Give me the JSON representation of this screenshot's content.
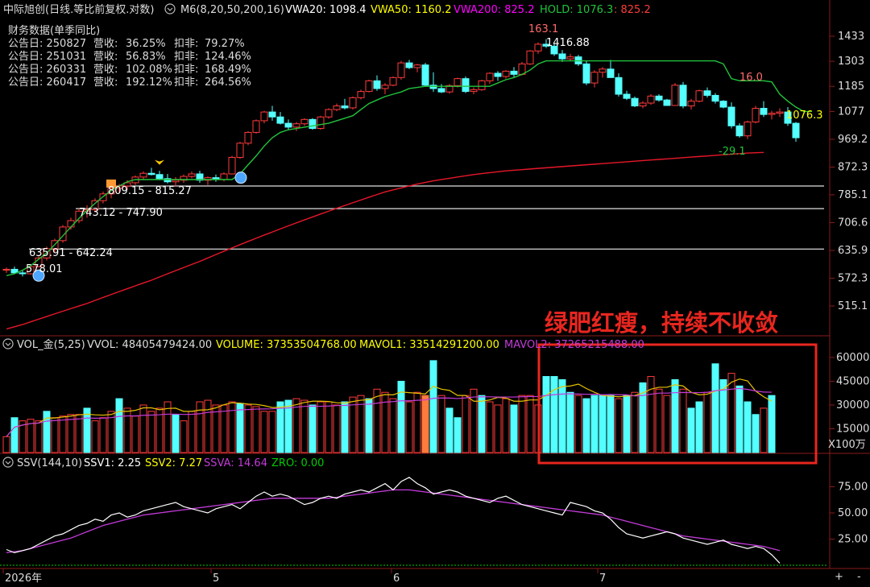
{
  "header": {
    "symbol": "中际旭创(日线.等比前复权.对数)",
    "indicator": "M6(8,20,50,200,16)",
    "vwa20": "VWA20: 1098.4",
    "vwa50": "VWA50: 1160.2",
    "vwa200": "VWA200: 825.2",
    "hold": "HOLD: 1076.3",
    "hold_extra": ": 825.2"
  },
  "finance": {
    "title": "财务数据(单季同比)",
    "rows": [
      {
        "date": "公告日: 250827",
        "rev_label": "营收:",
        "rev": "36.25%",
        "np_label": "扣非:",
        "np": "79.27%"
      },
      {
        "date": "公告日: 251031",
        "rev_label": "营收:",
        "rev": "56.83%",
        "np_label": "扣非:",
        "np": "124.46%"
      },
      {
        "date": "公告日: 260331",
        "rev_label": "营收:",
        "rev": "102.08%",
        "np_label": "扣非:",
        "np": "168.49%"
      },
      {
        "date": "公告日: 260417",
        "rev_label": "营收:",
        "rev": "192.12%",
        "np_label": "扣非:",
        "np": "264.56%"
      }
    ]
  },
  "annotations": {
    "high_pct": "163.1",
    "high_price": "1416.88",
    "low_price": "578.01",
    "range1": "635.91 - 642.24",
    "range2": "743.12 - 747.90",
    "range3": "809.15 - 815.27",
    "pct_16": "16.0",
    "pct_m29": "-29.1",
    "hold_label": "1076.3",
    "callout": "绿肥红瘦，持续不收敛"
  },
  "volume_header": {
    "name": "VOL_金(5,25)",
    "vvol": "VVOL: 48405479424.00",
    "volume": "VOLUME: 37353504768.00",
    "mavol1": "MAVOL1: 33514291200.00",
    "mavol2": "MAVOL2: 37265215488.00"
  },
  "ssv_header": {
    "name": "SSV(144,10)",
    "ssv1": "SSV1: 2.25",
    "ssv2": "SSV2: 7.27",
    "ssva": "SSVA: 14.64",
    "zro": "ZRO: 0.00"
  },
  "axes": {
    "price_ticks": [
      "1433",
      "1303",
      "1185",
      "1077",
      "969.2",
      "872.3",
      "785.1",
      "706.6",
      "635.9",
      "572.3",
      "515.1"
    ],
    "vol_ticks": [
      "60000",
      "45000",
      "30000",
      "15000"
    ],
    "vol_unit": "X100万",
    "ssv_ticks": [
      "75.00",
      "50.00",
      "25.00"
    ],
    "x_labels": [
      "2026年",
      "5",
      "6",
      "7"
    ],
    "zoom_plus": "+",
    "zoom_minus": "-"
  },
  "colors": {
    "up": "#ff3b3b",
    "down": "#54ffff",
    "vwa20": "#ffff00",
    "vwa50": "#ff00ff",
    "vwa200": "#e8172a",
    "hold": "#22c33c",
    "ssv1": "#ffffff",
    "ssva": "#c33bd9",
    "zro": "#00cc00",
    "callout": "#e8261f"
  },
  "chart_data": {
    "type": "candlestick",
    "title": "中际旭创(日线.等比前复权.对数)",
    "y_scale": "log",
    "ylim": [
      470,
      1500
    ],
    "candles": [
      [
        590,
        596,
        584,
        592
      ],
      [
        592,
        598,
        586,
        584
      ],
      [
        584,
        590,
        576,
        582
      ],
      [
        582,
        600,
        580,
        598
      ],
      [
        598,
        622,
        596,
        618
      ],
      [
        618,
        645,
        612,
        640
      ],
      [
        640,
        665,
        632,
        660
      ],
      [
        660,
        700,
        655,
        695
      ],
      [
        695,
        720,
        688,
        712
      ],
      [
        712,
        745,
        705,
        738
      ],
      [
        738,
        755,
        720,
        742
      ],
      [
        742,
        775,
        735,
        768
      ],
      [
        768,
        795,
        760,
        788
      ],
      [
        788,
        812,
        775,
        805
      ],
      [
        805,
        818,
        790,
        812
      ],
      [
        812,
        830,
        800,
        822
      ],
      [
        822,
        845,
        815,
        840
      ],
      [
        840,
        858,
        832,
        852
      ],
      [
        852,
        870,
        845,
        848
      ],
      [
        848,
        860,
        830,
        835
      ],
      [
        835,
        850,
        820,
        825
      ],
      [
        825,
        840,
        810,
        830
      ],
      [
        830,
        848,
        822,
        842
      ],
      [
        842,
        858,
        836,
        850
      ],
      [
        850,
        860,
        822,
        830
      ],
      [
        830,
        842,
        815,
        838
      ],
      [
        838,
        848,
        825,
        832
      ],
      [
        832,
        855,
        826,
        850
      ],
      [
        850,
        910,
        848,
        905
      ],
      [
        905,
        960,
        900,
        955
      ],
      [
        955,
        1000,
        948,
        995
      ],
      [
        995,
        1045,
        990,
        1040
      ],
      [
        1040,
        1080,
        1030,
        1075
      ],
      [
        1075,
        1100,
        1040,
        1055
      ],
      [
        1055,
        1075,
        1025,
        1030
      ],
      [
        1030,
        1045,
        1005,
        1015
      ],
      [
        1015,
        1035,
        1000,
        1028
      ],
      [
        1028,
        1050,
        1020,
        1045
      ],
      [
        1045,
        1050,
        1005,
        1010
      ],
      [
        1010,
        1060,
        1005,
        1055
      ],
      [
        1055,
        1090,
        1048,
        1085
      ],
      [
        1085,
        1110,
        1078,
        1100
      ],
      [
        1100,
        1130,
        1085,
        1092
      ],
      [
        1092,
        1140,
        1085,
        1135
      ],
      [
        1135,
        1170,
        1128,
        1162
      ],
      [
        1162,
        1215,
        1158,
        1210
      ],
      [
        1210,
        1235,
        1165,
        1175
      ],
      [
        1175,
        1200,
        1150,
        1190
      ],
      [
        1190,
        1230,
        1185,
        1225
      ],
      [
        1225,
        1305,
        1215,
        1295
      ],
      [
        1295,
        1310,
        1265,
        1272
      ],
      [
        1272,
        1290,
        1250,
        1285
      ],
      [
        1285,
        1295,
        1185,
        1190
      ],
      [
        1190,
        1250,
        1160,
        1175
      ],
      [
        1175,
        1195,
        1155,
        1160
      ],
      [
        1160,
        1195,
        1152,
        1188
      ],
      [
        1188,
        1225,
        1180,
        1220
      ],
      [
        1220,
        1230,
        1155,
        1162
      ],
      [
        1162,
        1180,
        1150,
        1170
      ],
      [
        1170,
        1215,
        1165,
        1210
      ],
      [
        1210,
        1250,
        1195,
        1245
      ],
      [
        1245,
        1255,
        1210,
        1230
      ],
      [
        1230,
        1260,
        1220,
        1255
      ],
      [
        1255,
        1275,
        1225,
        1240
      ],
      [
        1240,
        1300,
        1235,
        1290
      ],
      [
        1290,
        1360,
        1285,
        1355
      ],
      [
        1355,
        1400,
        1340,
        1390
      ],
      [
        1390,
        1417,
        1370,
        1380
      ],
      [
        1380,
        1395,
        1330,
        1340
      ],
      [
        1340,
        1360,
        1300,
        1315
      ],
      [
        1315,
        1340,
        1305,
        1325
      ],
      [
        1325,
        1335,
        1280,
        1290
      ],
      [
        1290,
        1305,
        1190,
        1200
      ],
      [
        1200,
        1260,
        1180,
        1250
      ],
      [
        1250,
        1275,
        1225,
        1265
      ],
      [
        1265,
        1310,
        1255,
        1225
      ],
      [
        1225,
        1245,
        1140,
        1150
      ],
      [
        1150,
        1165,
        1125,
        1132
      ],
      [
        1132,
        1140,
        1095,
        1100
      ],
      [
        1100,
        1120,
        1090,
        1112
      ],
      [
        1112,
        1150,
        1105,
        1142
      ],
      [
        1142,
        1150,
        1118,
        1125
      ],
      [
        1125,
        1130,
        1100,
        1102
      ],
      [
        1102,
        1200,
        1100,
        1190
      ],
      [
        1190,
        1205,
        1090,
        1100
      ],
      [
        1100,
        1130,
        1085,
        1120
      ],
      [
        1120,
        1170,
        1115,
        1165
      ],
      [
        1165,
        1180,
        1135,
        1145
      ],
      [
        1145,
        1155,
        1110,
        1120
      ],
      [
        1120,
        1125,
        1090,
        1095
      ],
      [
        1095,
        1115,
        1010,
        1020
      ],
      [
        1020,
        1030,
        975,
        982
      ],
      [
        982,
        1040,
        970,
        1035
      ],
      [
        1035,
        1100,
        1030,
        1090
      ],
      [
        1090,
        1120,
        1055,
        1065
      ],
      [
        1065,
        1080,
        1045,
        1070
      ],
      [
        1070,
        1090,
        1055,
        1075
      ],
      [
        1075,
        1095,
        1020,
        1030
      ],
      [
        1030,
        1035,
        960,
        975
      ]
    ],
    "vwa20": [
      578,
      582,
      590,
      600,
      615,
      630,
      650,
      672,
      695,
      718,
      740,
      760,
      780,
      798,
      812,
      825,
      832,
      832,
      832,
      832,
      832,
      832,
      832,
      832,
      832,
      832,
      832,
      832,
      832,
      850,
      880,
      910,
      945,
      975,
      995,
      1005,
      1010,
      1015,
      1020,
      1025,
      1030,
      1040,
      1050,
      1060,
      1085,
      1110,
      1125,
      1140,
      1150,
      1160,
      1175,
      1180,
      1185,
      1185,
      1185,
      1185,
      1185,
      1185,
      1185,
      1185,
      1185,
      1200,
      1215,
      1225,
      1240,
      1260,
      1290,
      1305,
      1305,
      1305,
      1305,
      1305,
      1305,
      1305,
      1305,
      1305,
      1305,
      1305,
      1305,
      1305,
      1305,
      1305,
      1305,
      1305,
      1305,
      1305,
      1305,
      1305,
      1305,
      1290,
      1220,
      1210,
      1210,
      1210,
      1210,
      1205,
      1150,
      1120,
      1095,
      1077,
      1077
    ],
    "vwa200": [
      472,
      476,
      480,
      485,
      490,
      495,
      500,
      505,
      510,
      515,
      520,
      526,
      532,
      538,
      544,
      550,
      556,
      562,
      568,
      575,
      582,
      589,
      596,
      603,
      610,
      618,
      626,
      634,
      642,
      650,
      658,
      666,
      674,
      682,
      690,
      698,
      706,
      714,
      722,
      730,
      738,
      746,
      754,
      762,
      770,
      778,
      786,
      794,
      800,
      806,
      812,
      818,
      823,
      828,
      832,
      836,
      840,
      844,
      848,
      851,
      854,
      857,
      860,
      862,
      864,
      866,
      868,
      870,
      872,
      874,
      876,
      878,
      880,
      882,
      884,
      886,
      888,
      890,
      892,
      894,
      896,
      898,
      900,
      902,
      904,
      906,
      908,
      910,
      912,
      914,
      916,
      918,
      920,
      921,
      922,
      823,
      824,
      825,
      825,
      825
    ],
    "volume": [
      10000,
      22000,
      20000,
      21000,
      20000,
      26000,
      22000,
      23000,
      24000,
      24000,
      28000,
      20000,
      22000,
      26000,
      34000,
      28000,
      23000,
      30000,
      26000,
      28000,
      32000,
      24000,
      20000,
      26000,
      32000,
      33000,
      30000,
      30000,
      32000,
      31000,
      30000,
      29000,
      26000,
      26000,
      32000,
      33000,
      34000,
      33000,
      30000,
      32000,
      32000,
      30000,
      32000,
      35000,
      36000,
      34000,
      40000,
      38000,
      34000,
      45000,
      32000,
      38000,
      36000,
      58000,
      36000,
      28000,
      22000,
      36000,
      40000,
      36000,
      32000,
      30000,
      34000,
      30000,
      36000,
      36000,
      30000,
      48000,
      48000,
      46000,
      38000,
      36000,
      34000,
      36000,
      36000,
      36000,
      34000,
      36000,
      38000,
      44000,
      48000,
      40000,
      36000,
      46000,
      40000,
      28000,
      32000,
      38000,
      56000,
      46000,
      50000,
      42000,
      32000,
      24000,
      28000,
      36000
    ],
    "vol_up": [
      true,
      false,
      true,
      true,
      true,
      false,
      true,
      true,
      true,
      true,
      false,
      true,
      true,
      true,
      false,
      true,
      true,
      true,
      true,
      true,
      true,
      false,
      true,
      true,
      true,
      true,
      true,
      true,
      true,
      false,
      true,
      true,
      true,
      true,
      false,
      false,
      true,
      true,
      false,
      true,
      true,
      true,
      false,
      true,
      true,
      false,
      true,
      true,
      true,
      false,
      true,
      true,
      false,
      false,
      true,
      false,
      false,
      true,
      true,
      false,
      true,
      true,
      true,
      false,
      true,
      true,
      true,
      false,
      false,
      false,
      false,
      true,
      false,
      false,
      false,
      false,
      true,
      false,
      true,
      false,
      true,
      true,
      true,
      false,
      true,
      false,
      false,
      true,
      false,
      false,
      true,
      false,
      false,
      false,
      true,
      false
    ],
    "vol_highlight_index": 52,
    "ssv1": [
      15,
      12,
      14,
      16,
      20,
      24,
      28,
      30,
      34,
      38,
      40,
      44,
      42,
      48,
      50,
      46,
      48,
      52,
      54,
      56,
      58,
      60,
      56,
      54,
      52,
      50,
      54,
      56,
      58,
      54,
      60,
      66,
      70,
      66,
      68,
      66,
      62,
      58,
      60,
      64,
      66,
      64,
      68,
      70,
      72,
      70,
      74,
      78,
      72,
      80,
      84,
      78,
      74,
      68,
      70,
      72,
      70,
      66,
      64,
      62,
      60,
      64,
      66,
      62,
      58,
      56,
      54,
      52,
      50,
      48,
      60,
      58,
      56,
      52,
      50,
      44,
      36,
      30,
      28,
      26,
      28,
      30,
      32,
      30,
      26,
      24,
      22,
      20,
      22,
      24,
      20,
      18,
      16,
      18,
      16,
      10,
      2
    ],
    "ssva": [
      12,
      13,
      14,
      16,
      18,
      20,
      22,
      24,
      26,
      29,
      32,
      35,
      38,
      40,
      42,
      44,
      46,
      48,
      49,
      50,
      51,
      52,
      53,
      54,
      55,
      56,
      57,
      58,
      59,
      60,
      61,
      62,
      63,
      64,
      64,
      64,
      64,
      64,
      64,
      64,
      64,
      65,
      66,
      67,
      68,
      69,
      70,
      71,
      72,
      72,
      72,
      71,
      70,
      69,
      68,
      67,
      66,
      65,
      64,
      63,
      62,
      61,
      60,
      59,
      58,
      57,
      56,
      55,
      54,
      53,
      52,
      51,
      50,
      49,
      48,
      46,
      44,
      42,
      40,
      38,
      36,
      34,
      32,
      30,
      28,
      27,
      26,
      25,
      24,
      23,
      22,
      21,
      20,
      19,
      18,
      16,
      14
    ]
  }
}
